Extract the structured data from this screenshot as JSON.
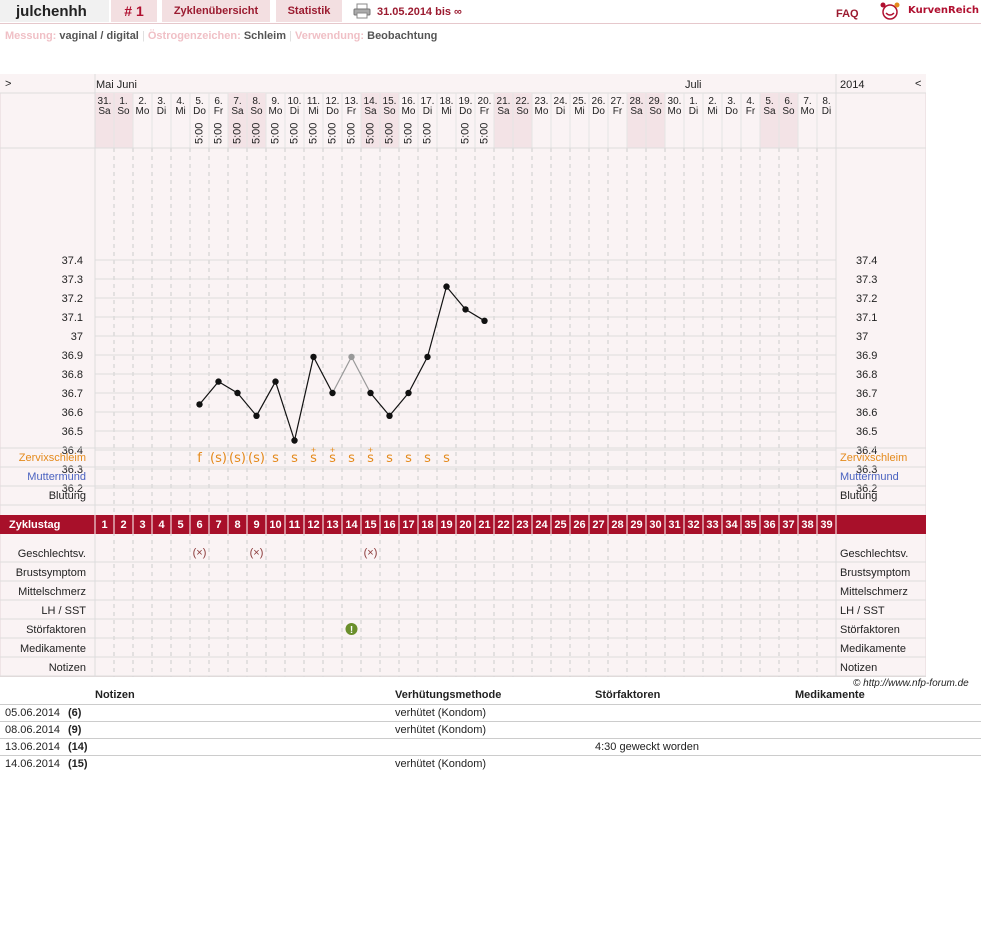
{
  "header": {
    "user": "julchenhh",
    "cycle_number": "# 1",
    "tab_cycles": "Zyklenübersicht",
    "tab_stats": "Statistik",
    "date_range": "31.05.2014 bis ∞",
    "faq": "FAQ",
    "logo_text": "KurvenReich"
  },
  "info": {
    "measure_label": "Messung:",
    "measure_value": "vaginal / digital",
    "estrogen_label": "Östrogenzeichen:",
    "estrogen_value": "Schleim",
    "usage_label": "Verwendung:",
    "usage_value": "Beobachtung"
  },
  "chart_data": {
    "type": "line",
    "nav_prev": ">",
    "nav_next": "<",
    "year": "2014",
    "month_labels": [
      {
        "text": "Mai Juni",
        "col": 0
      },
      {
        "text": "Juli",
        "col": 31
      }
    ],
    "days": [
      {
        "d": "31.",
        "w": "Sa",
        "we": true
      },
      {
        "d": "1.",
        "w": "So",
        "we": true
      },
      {
        "d": "2.",
        "w": "Mo"
      },
      {
        "d": "3.",
        "w": "Di"
      },
      {
        "d": "4.",
        "w": "Mi"
      },
      {
        "d": "5.",
        "w": "Do"
      },
      {
        "d": "6.",
        "w": "Fr"
      },
      {
        "d": "7.",
        "w": "Sa",
        "we": true
      },
      {
        "d": "8.",
        "w": "So",
        "we": true
      },
      {
        "d": "9.",
        "w": "Mo"
      },
      {
        "d": "10.",
        "w": "Di"
      },
      {
        "d": "11.",
        "w": "Mi"
      },
      {
        "d": "12.",
        "w": "Do"
      },
      {
        "d": "13.",
        "w": "Fr"
      },
      {
        "d": "14.",
        "w": "Sa",
        "we": true
      },
      {
        "d": "15.",
        "w": "So",
        "we": true
      },
      {
        "d": "16.",
        "w": "Mo"
      },
      {
        "d": "17.",
        "w": "Di"
      },
      {
        "d": "18.",
        "w": "Mi"
      },
      {
        "d": "19.",
        "w": "Do"
      },
      {
        "d": "20.",
        "w": "Fr"
      },
      {
        "d": "21.",
        "w": "Sa",
        "we": true
      },
      {
        "d": "22.",
        "w": "So",
        "we": true
      },
      {
        "d": "23.",
        "w": "Mo"
      },
      {
        "d": "24.",
        "w": "Di"
      },
      {
        "d": "25.",
        "w": "Mi"
      },
      {
        "d": "26.",
        "w": "Do"
      },
      {
        "d": "27.",
        "w": "Fr"
      },
      {
        "d": "28.",
        "w": "Sa",
        "we": true
      },
      {
        "d": "29.",
        "w": "So",
        "we": true
      },
      {
        "d": "30.",
        "w": "Mo"
      },
      {
        "d": "1.",
        "w": "Di"
      },
      {
        "d": "2.",
        "w": "Mi"
      },
      {
        "d": "3.",
        "w": "Do"
      },
      {
        "d": "4.",
        "w": "Fr"
      },
      {
        "d": "5.",
        "w": "Sa",
        "we": true
      },
      {
        "d": "6.",
        "w": "So",
        "we": true
      },
      {
        "d": "7.",
        "w": "Mo"
      },
      {
        "d": "8.",
        "w": "Di"
      }
    ],
    "times": {
      "5": "5:00",
      "6": "5:00",
      "7": "5:00",
      "8": "5:00",
      "9": "5:00",
      "10": "5:00",
      "11": "5:00",
      "12": "5:00",
      "13": "5:00",
      "14": "5:00",
      "15": "5:00",
      "16": "5:00",
      "17": "5:00",
      "19": "5:00",
      "20": "5:00"
    },
    "y_ticks": [
      "37.4",
      "37.3",
      "37.2",
      "37.1",
      "37",
      "36.9",
      "36.8",
      "36.7",
      "36.6",
      "36.5",
      "36.4",
      "36.3",
      "36.2"
    ],
    "ylim": [
      36.2,
      37.4
    ],
    "series": [
      {
        "points": [
          {
            "cycle_day": 6,
            "temp": 36.64
          },
          {
            "cycle_day": 7,
            "temp": 36.76
          },
          {
            "cycle_day": 8,
            "temp": 36.7
          },
          {
            "cycle_day": 9,
            "temp": 36.58
          },
          {
            "cycle_day": 10,
            "temp": 36.76
          },
          {
            "cycle_day": 11,
            "temp": 36.45
          },
          {
            "cycle_day": 12,
            "temp": 36.89
          },
          {
            "cycle_day": 13,
            "temp": 36.7
          },
          {
            "cycle_day": 14,
            "temp": 36.89,
            "excluded": true
          },
          {
            "cycle_day": 15,
            "temp": 36.7
          },
          {
            "cycle_day": 16,
            "temp": 36.58
          },
          {
            "cycle_day": 17,
            "temp": 36.7
          },
          {
            "cycle_day": 18,
            "temp": 36.89
          },
          {
            "cycle_day": 19,
            "temp": 37.26
          },
          {
            "cycle_day": 20,
            "temp": 37.14
          },
          {
            "cycle_day": 21,
            "temp": 37.08
          }
        ]
      }
    ],
    "rows": {
      "cervix_label": "Zervixschleim",
      "mouth_label": "Muttermund",
      "bleeding_label": "Blutung",
      "cycle_label": "Zyklustag",
      "sex_label": "Geschlechtsv.",
      "breast_label": "Brustsymptom",
      "pain_label": "Mittelschmerz",
      "lh_label": "LH / SST",
      "disturb_label": "Störfaktoren",
      "med_label": "Medikamente",
      "notes_label": "Notizen"
    },
    "cervix": {
      "6": "f",
      "7": "(s)",
      "8": "(s)",
      "9": "(s)",
      "10": "s",
      "11": "s",
      "12": "s+",
      "13": "s+",
      "14": "s",
      "15": "s+",
      "16": "s",
      "17": "s",
      "18": "s",
      "19": "s"
    },
    "cycle_days": [
      "1",
      "2",
      "3",
      "4",
      "5",
      "6",
      "7",
      "8",
      "9",
      "10",
      "11",
      "12",
      "13",
      "14",
      "15",
      "16",
      "17",
      "18",
      "19",
      "20",
      "21",
      "22",
      "23",
      "24",
      "25",
      "26",
      "27",
      "28",
      "29",
      "30",
      "31",
      "32",
      "33",
      "34",
      "35",
      "36",
      "37",
      "38",
      "39"
    ],
    "sex_days": [
      6,
      9,
      15
    ],
    "disturb_days": [
      14
    ],
    "colors": {
      "accent": "#a8102a",
      "weekend": "#f3e3e6",
      "grid_bg": "#faf3f4",
      "cervix": "#e48a1c",
      "mouth": "#4a62c0",
      "disturb": "#6b8f2c"
    }
  },
  "copyright": "© http://www.nfp-forum.de",
  "notes": {
    "headers": [
      "Notizen",
      "Verhütungsmethode",
      "Störfaktoren",
      "Medikamente"
    ],
    "rows": [
      {
        "date": "05.06.2014",
        "day": "(6)",
        "method": "verhütet (Kondom)",
        "disturb": ""
      },
      {
        "date": "08.06.2014",
        "day": "(9)",
        "method": "verhütet (Kondom)",
        "disturb": ""
      },
      {
        "date": "13.06.2014",
        "day": "(14)",
        "method": "",
        "disturb": "4:30 geweckt worden"
      },
      {
        "date": "14.06.2014",
        "day": "(15)",
        "method": "verhütet (Kondom)",
        "disturb": ""
      }
    ]
  }
}
